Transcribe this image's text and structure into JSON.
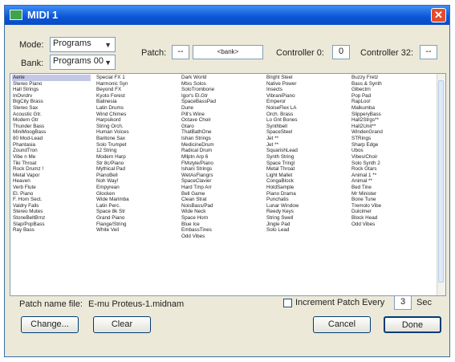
{
  "window": {
    "title": "MIDI 1",
    "close_glyph": "✕",
    "app_icon": "midi-app-icon"
  },
  "mode": {
    "label": "Mode:",
    "value": "Programs",
    "chevron": "▼"
  },
  "bank": {
    "label": "Bank:",
    "value": "Programs 00",
    "chevron": "▼"
  },
  "patch": {
    "label": "Patch:",
    "value": "--",
    "bank_value": "<bank>"
  },
  "controller0": {
    "label": "Controller 0:",
    "value": "0"
  },
  "controller32": {
    "label": "Controller 32:",
    "value": "--"
  },
  "patch_list": {
    "columns": [
      [
        "Aerie",
        "Stereo Piano",
        "Hall Strings",
        "InOvrdrv",
        "BigCity Brass",
        "Stereo Sax",
        "Acoustic Gtr.",
        "Modern Gtr",
        "Thunder Bass",
        "MiniMoogBass",
        "80 Mod-Lead",
        "Phantasia",
        "ZoundTron",
        "Vibe n Me",
        "Tiki Throat",
        "Rock Drumz !",
        "Metal Vapor",
        "Heaven",
        "Verb Flute",
        "El. Piano",
        "F. Horn Sect.",
        "Valdry Falls",
        "Stereo Mutes",
        "StoneBeltBrnz",
        "Slap/PopBass",
        "Ray Bass"
      ],
      [
        "Special FX 1",
        "Harmonic Syn",
        "Beyond FX",
        "Kyoto Forest",
        "Balinesia",
        "Latin Drums",
        "Wind Chimes",
        "Harpsikord",
        "String Orch.",
        "Human Voices",
        "Baritone Sax",
        "Solo Trumpet",
        "12 String",
        "Modern Harp",
        "Str 8c/Piano",
        "Mythical Pad",
        "PianoBell",
        "Noh Way!",
        "Empyrean",
        "Glocken",
        "Wide Marimba",
        "Latin Perc.",
        "Space 8k Str",
        "Grand Piano",
        "Flange/String",
        "White Veil"
      ],
      [
        "Dark World",
        "Mtxs Solos",
        "SoloTrombone",
        "Igor's El.Gtr",
        "SpaceBassPad",
        "Dune",
        "Pill's Wine",
        "Octave Choir",
        "Gtaro",
        "ThatBathOne",
        "Ishan Strings",
        "MedicineDrum",
        "Radical Drum",
        "Mllptn Arp 6",
        "FMstyle/Piano",
        "Ishani Strings",
        "WetAsFlangrs",
        "SpaceClavier",
        "Hard Tmp Arr",
        "Bell Game",
        "Clean Strat",
        "NoisBass/Pad",
        "Wide Neck",
        "Space Horn",
        "Blue Ice",
        "EmbassTines",
        "Odd Vibes"
      ],
      [
        "Bright Steel",
        "Native Power",
        "Insects",
        "VibraniPiano",
        "Emperor",
        "NoiseFlex LA",
        "Orch. Brass",
        "Lo Gnt Bones",
        "Synthbell",
        "SpaceSteel",
        "Jet **",
        "Jet **",
        "SquarishLead",
        "Synth String",
        "Space Tringl",
        "Metal Throat",
        "Light Mallet",
        "CongaBlock",
        "HoldSample",
        "Piano Drama",
        "Punchatis",
        "Lunar Window",
        "Reedy Keys",
        "String Swell",
        "Jingle Pad",
        "Solo Lead"
      ],
      [
        "Buzzy Fretz",
        "Bass & Synth",
        "Glbectrn",
        "Pop Pad",
        "RapLoo!",
        "Malkumba",
        "SlipperyBass",
        "Hall2Strgs**",
        "Hall2Unit**",
        "WindenGrand",
        "STRings",
        "Sharp Edge",
        "Ubos",
        "Vibes/Choir",
        "Solo Synth 2",
        "Rock Gtars",
        "Animal 1 **",
        "Animal **",
        "Bed Tine",
        "Mr Minister",
        "Bone Tune",
        "Tremolo Vibe",
        "Dulcimer",
        "Block Head",
        "Odd Vibes"
      ]
    ],
    "selected_index": 0
  },
  "footer": {
    "patch_file_label": "Patch name file:",
    "patch_file_value": "E-mu Proteus-1.midnam",
    "increment_label": "Increment Patch Every",
    "increment_checked": false,
    "increment_value": "3",
    "increment_unit": "Sec",
    "change_label": "Change...",
    "clear_label": "Clear",
    "cancel_label": "Cancel",
    "done_label": "Done"
  }
}
